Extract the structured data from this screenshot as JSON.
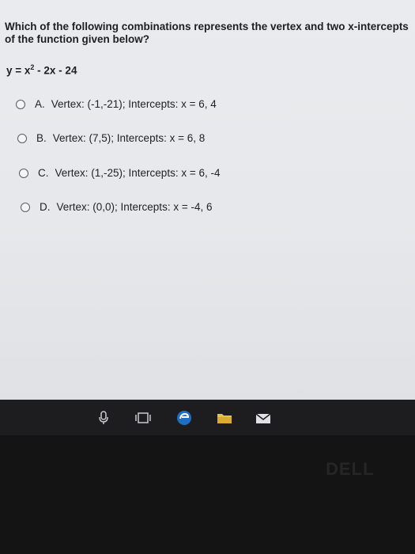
{
  "question": {
    "text": "Which of the following combinations represents the vertex and two x-intercepts of the function given below?",
    "equation_prefix": "y = x",
    "equation_exp": "2",
    "equation_suffix": " - 2x - 24"
  },
  "options": [
    {
      "letter": "A.",
      "text": "Vertex: (-1,-21); Intercepts: x = 6, 4"
    },
    {
      "letter": "B.",
      "text": "Vertex: (7,5); Intercepts: x = 6, 8"
    },
    {
      "letter": "C.",
      "text": "Vertex: (1,-25); Intercepts: x = 6, -4"
    },
    {
      "letter": "D.",
      "text": "Vertex: (0,0); Intercepts: x = -4, 6"
    }
  ],
  "taskbar": {
    "icons": [
      "microphone-icon",
      "task-view-icon",
      "edge-browser-icon",
      "file-explorer-icon",
      "mail-icon"
    ]
  },
  "colors": {
    "edge_blue": "#1e6fc4",
    "explorer_yellow": "#e8c14b"
  },
  "logo": "DELL"
}
